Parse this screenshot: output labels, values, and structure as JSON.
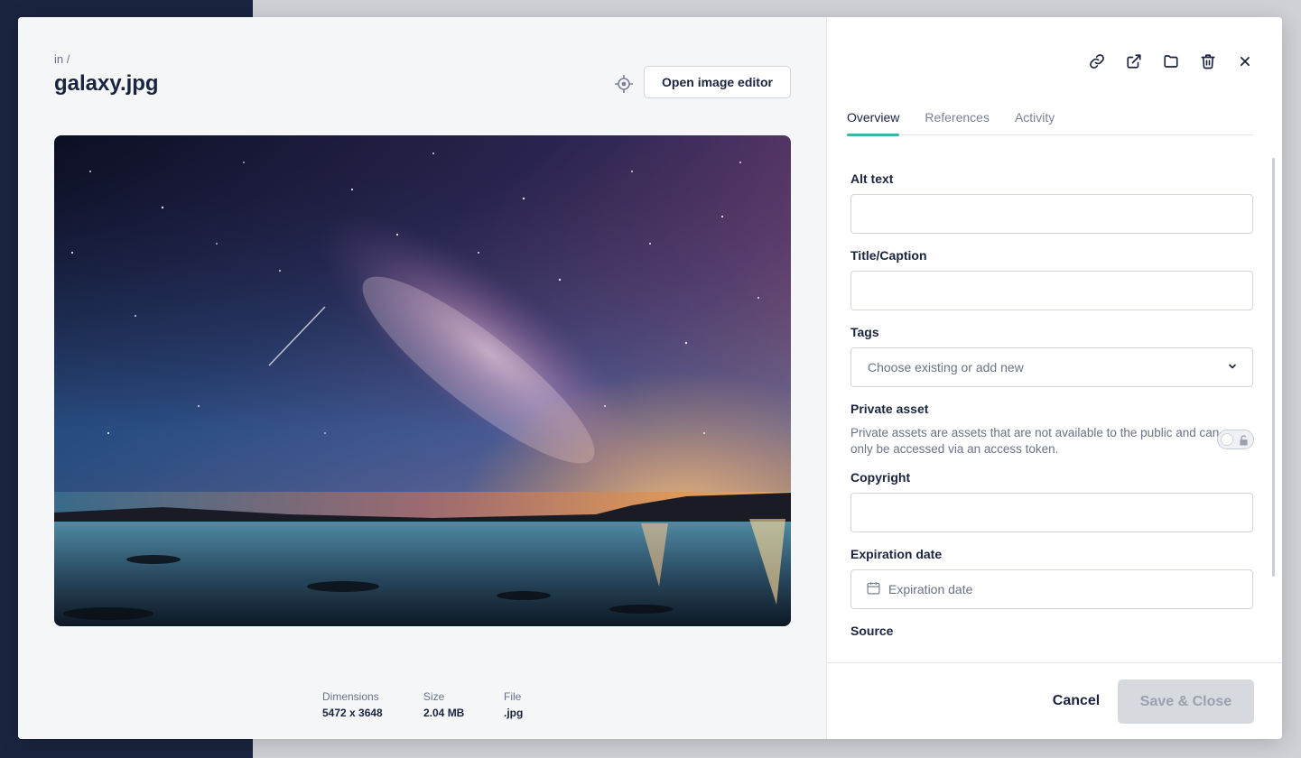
{
  "preview": {
    "breadcrumb": "in /",
    "file_name": "galaxy.jpg",
    "open_editor_label": "Open image editor",
    "image_alt": "Milky way galaxy over a calm sea at night",
    "meta": {
      "dimensions_label": "Dimensions",
      "dimensions_value": "5472 x 3648",
      "size_label": "Size",
      "size_value": "2.04 MB",
      "file_label": "File",
      "file_value": ".jpg"
    }
  },
  "panel": {
    "icons": [
      "link-icon",
      "open-external-icon",
      "folder-icon",
      "trash-icon",
      "close-icon"
    ],
    "tabs": [
      {
        "label": "Overview",
        "active": true
      },
      {
        "label": "References",
        "active": false
      },
      {
        "label": "Activity",
        "active": false
      }
    ],
    "fields": {
      "alt_text_label": "Alt text",
      "alt_text_value": "",
      "title_caption_label": "Title/Caption",
      "title_caption_value": "",
      "tags_label": "Tags",
      "tags_placeholder": "Choose existing or add new",
      "private_asset_label": "Private asset",
      "private_asset_description": "Private assets are assets that are not available to the public and can only be accessed via an access token.",
      "private_asset_enabled": false,
      "copyright_label": "Copyright",
      "copyright_value": "",
      "expiration_date_label": "Expiration date",
      "expiration_date_placeholder": "Expiration date",
      "source_label": "Source"
    },
    "footer": {
      "cancel_label": "Cancel",
      "save_label": "Save & Close"
    }
  },
  "colors": {
    "accent": "#3bb3a6",
    "text_primary": "#1b243f",
    "text_muted": "#6b7287",
    "save_disabled_bg": "#d6d9de"
  }
}
